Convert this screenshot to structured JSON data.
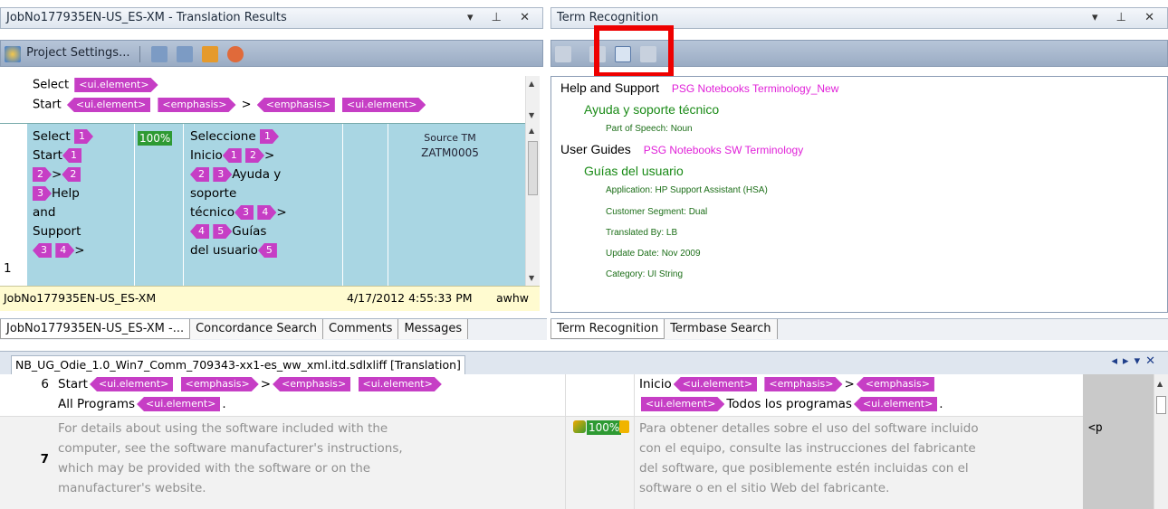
{
  "translation_results": {
    "title": "JobNo177935EN-US_ES-XM - Translation Results",
    "project_settings": "Project Settings...",
    "source_tags": {
      "select": "Select",
      "ui_element": "<ui.element>",
      "start": "Start",
      "emphasis": "<emphasis>",
      "gt": ">"
    },
    "row": {
      "number": "1",
      "src_words": [
        "Select",
        "Start",
        "Help",
        "and",
        "Support"
      ],
      "src_nums": [
        "1",
        "1",
        "2",
        "2",
        "3",
        "3",
        "4"
      ],
      "match": "100%",
      "tgt_words": [
        "Seleccione",
        "Inicio",
        "Ayuda y",
        "soporte",
        "técnico",
        "Guías",
        "del usuario"
      ],
      "tgt_nums": [
        "1",
        "1",
        "2",
        "2",
        "3",
        "3",
        "4",
        "4",
        "5",
        "5"
      ],
      "gt": ">",
      "source_label": "Source TM",
      "source_id": "ZATM0005"
    },
    "status_name": "JobNo177935EN-US_ES-XM",
    "status_date": "4/17/2012 4:55:33 PM",
    "status_user": "awhw"
  },
  "left_tabs": [
    "JobNo177935EN-US_ES-XM -...",
    "Concordance Search",
    "Comments",
    "Messages"
  ],
  "term_recognition": {
    "title": "Term Recognition",
    "terms": [
      {
        "source": "Help and Support",
        "termbase": "PSG Notebooks Terminology_New",
        "target": "Ayuda y soporte técnico",
        "fields": [
          "Part of Speech: Noun"
        ]
      },
      {
        "source": "User Guides",
        "termbase": "PSG Notebooks SW Terminology",
        "target": "Guías del usuario",
        "fields": [
          "Application: HP Support Assistant (HSA)",
          "Customer Segment: Dual",
          "Translated By: LB",
          "Update Date: Nov 2009",
          "Category: UI String"
        ]
      }
    ]
  },
  "right_tabs": [
    "Term Recognition",
    "Termbase Search"
  ],
  "editor": {
    "file_tab": "NB_UG_Odie_1.0_Win7_Comm_709343-xx1-es_ww_xml.itd.sdlxliff [Translation]",
    "seg6": {
      "num": "6",
      "src_start": "Start",
      "src_allprog": "All Programs",
      "tgt_inicio": "Inicio",
      "tgt_todos": "Todos los programas",
      "dot": "."
    },
    "seg7": {
      "num": "7",
      "source_lines": [
        "For details about using the software included with the",
        "computer, see the software manufacturer's instructions,",
        "which may be provided with the software or on the",
        "manufacturer's website."
      ],
      "match": "100%",
      "target_lines": [
        "Para obtener detalles sobre el uso del software incluido",
        "con el equipo, consulte las instrucciones del fabricante",
        "del software, que posiblemente estén incluidas con el",
        "software o en el sitio Web del fabricante."
      ],
      "struct": "<p"
    }
  },
  "colors": {
    "tag": "#c63ec5",
    "highlight_row": "#a9d6e3",
    "match_green": "#2e9a33",
    "termbase": "#e020d8",
    "target_term": "#198a16",
    "callout": "#ee0000"
  }
}
